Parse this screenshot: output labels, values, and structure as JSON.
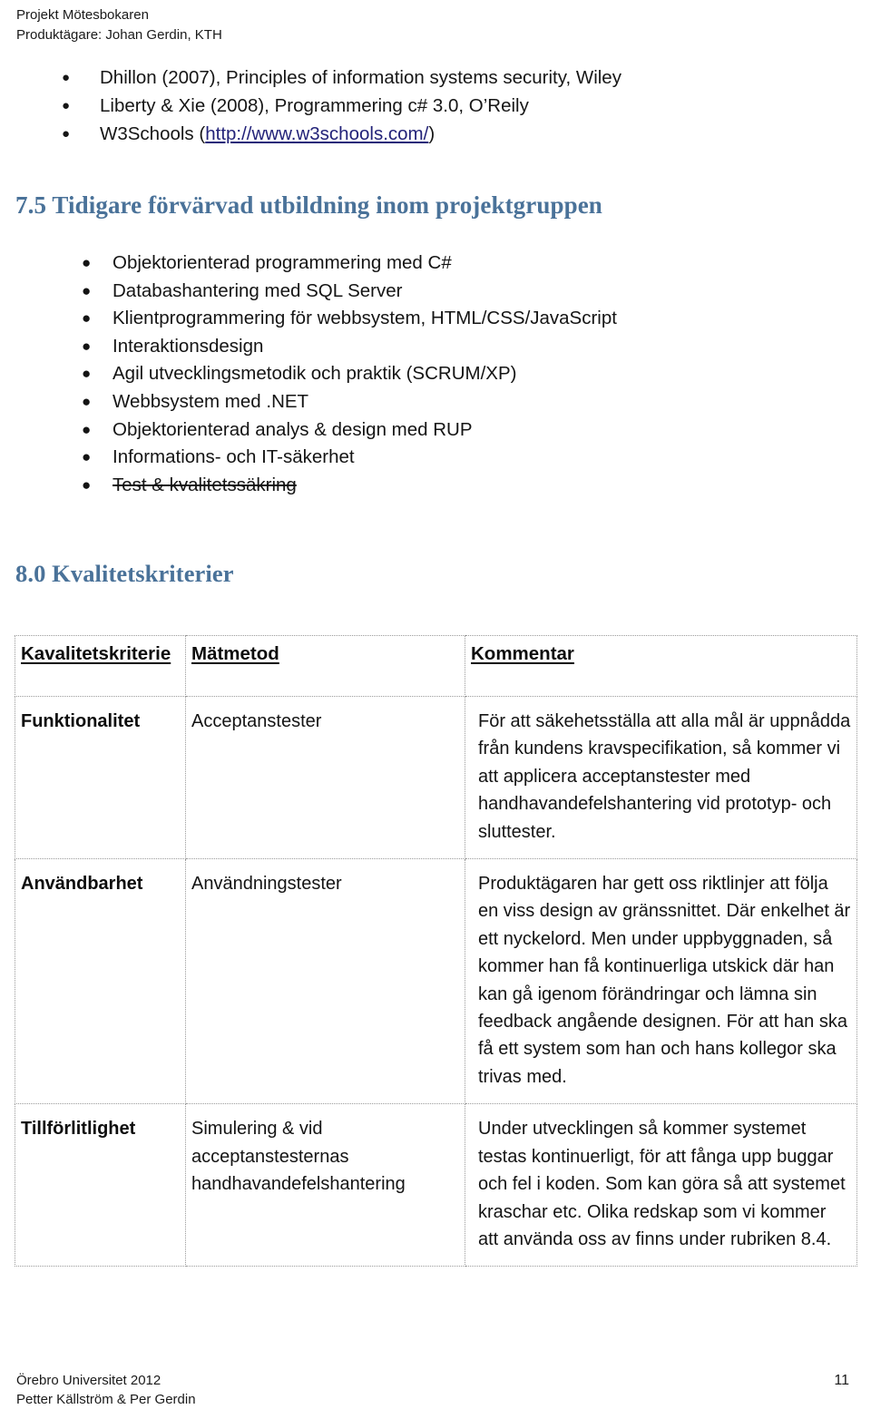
{
  "doc_header": {
    "line1": "Projekt Mötesbokaren",
    "line2": "Produktägare: Johan Gerdin, KTH"
  },
  "references": {
    "items": [
      {
        "bullet": "bullet-dot",
        "text": "Dhillon (2007), Principles of information systems security, Wiley"
      },
      {
        "bullet": "bullet-dot",
        "text": "Liberty & Xie (2008), Programmering c# 3.0, O’Reily"
      }
    ],
    "w3schools": {
      "prefix": "W3Schools (",
      "link_text": "http://www.w3schools.com/",
      "suffix": ")",
      "link_color": "#232379"
    }
  },
  "section_75": {
    "heading": "7.5 Tidigare förvärvad utbildning inom projektgruppen",
    "heading_color": "#4a7299",
    "items": [
      {
        "text": "Objektorienterad programmering med C#",
        "struck": false
      },
      {
        "text": "Databashantering med SQL Server",
        "struck": false
      },
      {
        "text": "Klientprogrammering för webbsystem, HTML/CSS/JavaScript",
        "struck": false
      },
      {
        "text": "Interaktionsdesign",
        "struck": false
      },
      {
        "text": "Agil utvecklingsmetodik och praktik (SCRUM/XP)",
        "struck": false
      },
      {
        "text": "Webbsystem med .NET",
        "struck": false
      },
      {
        "text": "Objektorienterad analys & design med RUP",
        "struck": false
      },
      {
        "text": "Informations- och IT-säkerhet",
        "struck": false
      },
      {
        "text": "Test & kvalitetssäkring",
        "struck": true
      }
    ]
  },
  "section_80": {
    "heading": "8.0 Kvalitetskriterier",
    "heading_color": "#4a7299",
    "table": {
      "columns": [
        "Kavalitetskriterie",
        "Mätmetod",
        "Kommentar"
      ],
      "rows": [
        {
          "criterion": "Funktionalitet",
          "method": "Acceptanstester",
          "comment": "För att säkehetsställa att alla mål är uppnådda från kundens kravspecifikation, så kommer vi att applicera acceptanstester med handhavandefelshantering vid prototyp- och sluttester."
        },
        {
          "criterion": "Användbarhet",
          "method": "Användningstester",
          "comment": "Produktägaren har gett oss riktlinjer att följa en viss design av gränssnittet. Där enkelhet är ett nyckelord. Men under uppbyggnaden, så kommer han få kontinuerliga utskick där han kan gå igenom förändringar och lämna sin feedback angående designen. För att han ska få ett system som han och hans kollegor ska trivas med."
        },
        {
          "criterion": "Tillförlitlighet",
          "method": "Simulering & vid acceptanstesternas handhavandefelshantering",
          "comment": "Under utvecklingen så kommer systemet testas kontinuerligt, för att fånga upp buggar och fel i koden. Som kan göra så att systemet kraschar etc. Olika redskap som vi kommer att använda oss av finns under rubriken 8.4."
        }
      ]
    }
  },
  "doc_footer": {
    "line1": "Örebro Universitet 2012",
    "line2": "Petter Källström & Per Gerdin",
    "page_number": "11"
  }
}
